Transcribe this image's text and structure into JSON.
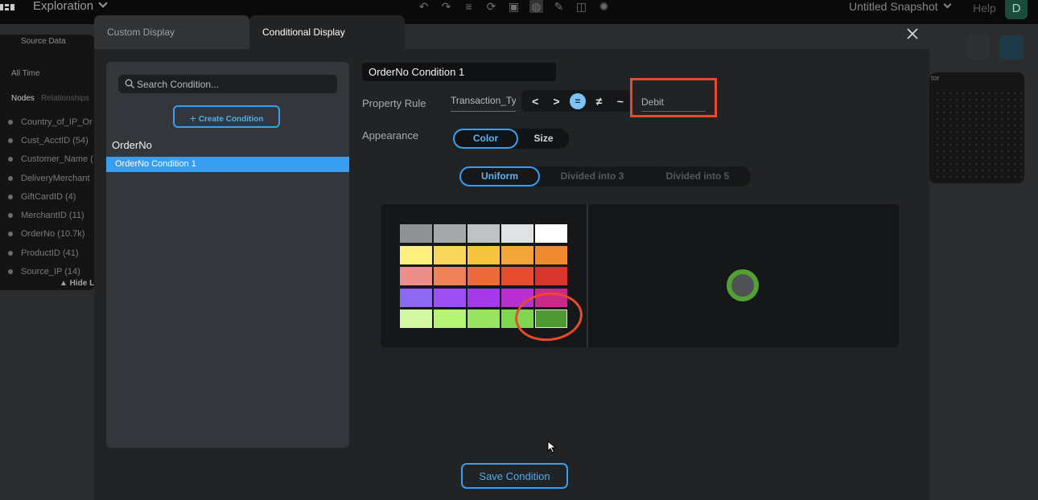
{
  "app": {
    "title": "Exploration",
    "snapshot": "Untitled Snapshot",
    "help": "Help",
    "avatar_initial": "D"
  },
  "background": {
    "source_data": "Source Data",
    "time_filter": "All Time",
    "tab_nodes": "Nodes",
    "tab_relationships": "Relationships",
    "node_types": [
      "Country_of_IP_Or",
      "Cust_AcctID (54)",
      "Customer_Name (",
      "DeliveryMerchant",
      "GiftCardID (4)",
      "MerchantID (11)",
      "OrderNo (10.7k)",
      "ProductID (41)",
      "Source_IP (14)"
    ],
    "hide_label": "▲ Hide L",
    "card_label": "tor"
  },
  "modal": {
    "tabs": [
      {
        "label": "Custom Display",
        "active": false
      },
      {
        "label": "Conditional Display",
        "active": true
      }
    ],
    "search_placeholder": "Search Condition...",
    "create_button": "Create Condition",
    "group_label": "OrderNo",
    "conditions": [
      "OrderNo Condition 1"
    ],
    "condition_name": "OrderNo Condition 1",
    "property_rule_label": "Property Rule",
    "property": "Transaction_Type",
    "operators": [
      "<",
      ">",
      "=",
      "≠",
      "~"
    ],
    "active_operator": "=",
    "rule_value": "Debit",
    "appearance_label": "Appearance",
    "appearance_options": [
      "Color",
      "Size"
    ],
    "appearance_selected": "Color",
    "division_options": [
      "Uniform",
      "Divided into 3",
      "Divided into 5"
    ],
    "division_selected": "Uniform",
    "swatches": [
      [
        "#8f9192",
        "#a6a9ab",
        "#bfc2c4",
        "#dfe1e2",
        "#ffffff"
      ],
      [
        "#fdf07f",
        "#f8d55b",
        "#f6c43f",
        "#f2a63a",
        "#ef8a33"
      ],
      [
        "#ec8f8a",
        "#ee8358",
        "#ec6a3b",
        "#e84c2f",
        "#d8352c"
      ],
      [
        "#8c68f4",
        "#9c4ff2",
        "#a43ae9",
        "#b82fd0",
        "#c82a8c"
      ],
      [
        "#d2f8a4",
        "#b6f574",
        "#96e460",
        "#7ed74f",
        "#4f9932"
      ]
    ],
    "selected_swatch": "#4f9932",
    "preview_color": "#53a035",
    "save_button": "Save Condition"
  }
}
